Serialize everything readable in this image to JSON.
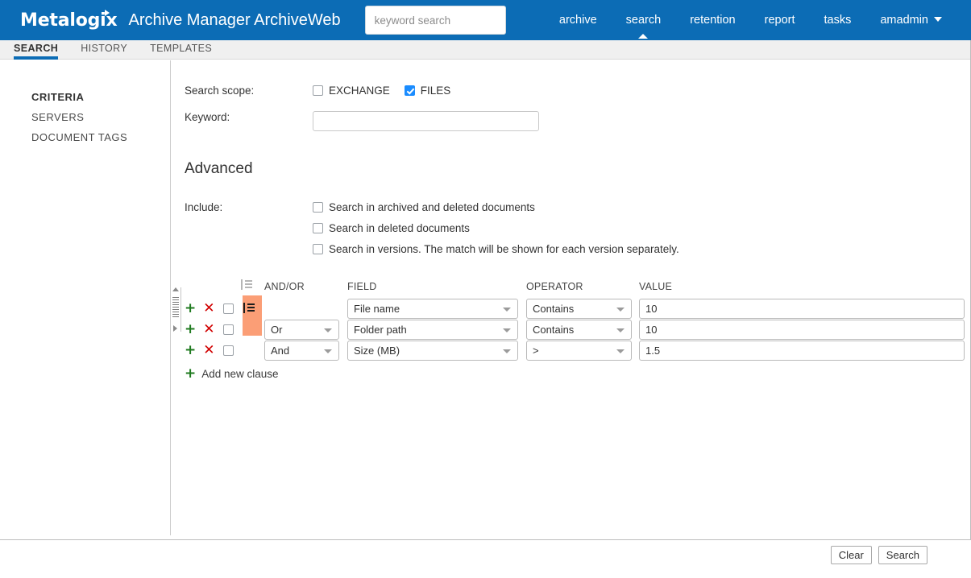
{
  "header": {
    "brand": "Metalogix",
    "app_title": "Archive Manager ArchiveWeb",
    "search": {
      "placeholder": "keyword search",
      "value": ""
    },
    "nav": [
      {
        "label": "archive",
        "active": false
      },
      {
        "label": "search",
        "active": true
      },
      {
        "label": "retention",
        "active": false
      },
      {
        "label": "report",
        "active": false
      },
      {
        "label": "tasks",
        "active": false
      }
    ],
    "user": {
      "label": "amadmin",
      "icon": "chevron-down-icon"
    },
    "brand_color": "#0c6cb5"
  },
  "tabs": [
    {
      "label": "SEARCH",
      "active": true
    },
    {
      "label": "HISTORY",
      "active": false
    },
    {
      "label": "TEMPLATES",
      "active": false
    }
  ],
  "sidebar": {
    "items": [
      {
        "label": "CRITERIA",
        "active": true
      },
      {
        "label": "SERVERS",
        "active": false
      },
      {
        "label": "DOCUMENT TAGS",
        "active": false
      }
    ]
  },
  "form": {
    "scope_label": "Search scope:",
    "scope_options": [
      {
        "label": "EXCHANGE",
        "checked": false
      },
      {
        "label": "FILES",
        "checked": true
      }
    ],
    "keyword_label": "Keyword:",
    "keyword_value": "",
    "keyword_placeholder": "",
    "advanced_title": "Advanced",
    "include_label": "Include:",
    "include_options": [
      {
        "label": "Search in archived and deleted documents",
        "checked": false
      },
      {
        "label": "Search in deleted documents",
        "checked": false
      },
      {
        "label": "Search in versions. The match will be shown for each version separately.",
        "checked": false
      }
    ]
  },
  "clauses": {
    "columns": {
      "group_icon": "group-bracket-icon",
      "andor": "AND/OR",
      "field": "FIELD",
      "operator": "OPERATOR",
      "value": "VALUE"
    },
    "rows": [
      {
        "add_icon": "plus-icon",
        "delete_icon": "x-icon",
        "selected": false,
        "group_icon": "group-bracket-icon",
        "grouped": true,
        "andor": "",
        "field": "File name",
        "operator": "Contains",
        "value": "10"
      },
      {
        "add_icon": "plus-icon",
        "delete_icon": "x-icon",
        "selected": false,
        "group_icon": "",
        "grouped": true,
        "andor": "Or",
        "field": "Folder path",
        "operator": "Contains",
        "value": "10"
      },
      {
        "add_icon": "plus-icon",
        "delete_icon": "x-icon",
        "selected": false,
        "group_icon": "",
        "grouped": false,
        "andor": "And",
        "field": "Size (MB)",
        "operator": ">",
        "value": "1.5"
      }
    ],
    "add_new_label": "Add new clause",
    "add_new_icon": "plus-icon",
    "group_highlight_color": "#fb9e76"
  },
  "footer": {
    "clear_label": "Clear",
    "search_label": "Search"
  }
}
